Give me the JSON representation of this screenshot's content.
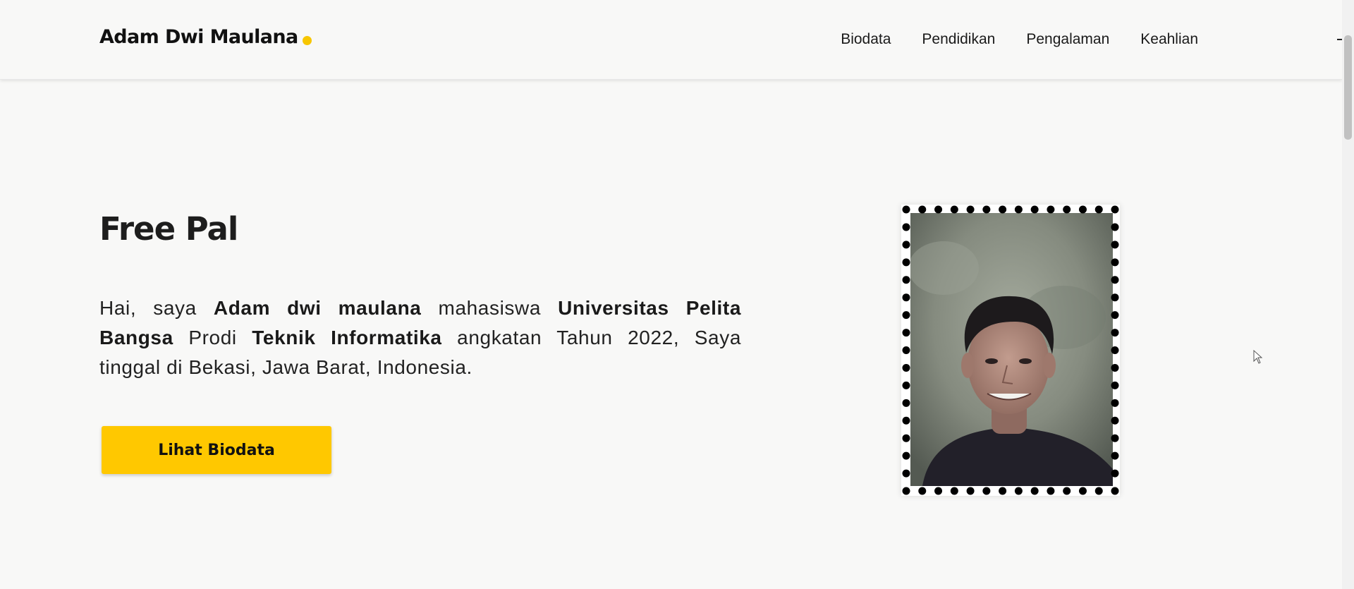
{
  "navbar": {
    "brand": "Adam Dwi Maulana",
    "brand_dot_color": "#f7c600",
    "links": [
      "Biodata",
      "Pendidikan",
      "Pengalaman",
      "Keahlian"
    ]
  },
  "hero": {
    "title": "Free Pal",
    "intro_parts": [
      {
        "text": "Hai, saya ",
        "bold": false
      },
      {
        "text": "Adam dwi maulana",
        "bold": true
      },
      {
        "text": " mahasiswa ",
        "bold": false
      },
      {
        "text": "Universitas Pelita Bangsa",
        "bold": true
      },
      {
        "text": " Prodi ",
        "bold": false
      },
      {
        "text": "Teknik Informatika",
        "bold": true
      },
      {
        "text": " angkatan Tahun 2022, Saya tinggal di Bekasi, Jawa Barat, Indonesia.",
        "bold": false
      }
    ],
    "cta_label": "Lihat Biodata",
    "cta_color": "#ffc800"
  },
  "photo": {
    "frame_style": "dotted-stamp-border",
    "subject": "profile-photo"
  },
  "colors": {
    "background": "#f8f8f7",
    "accent": "#ffc800",
    "text": "#1f1f1f"
  }
}
